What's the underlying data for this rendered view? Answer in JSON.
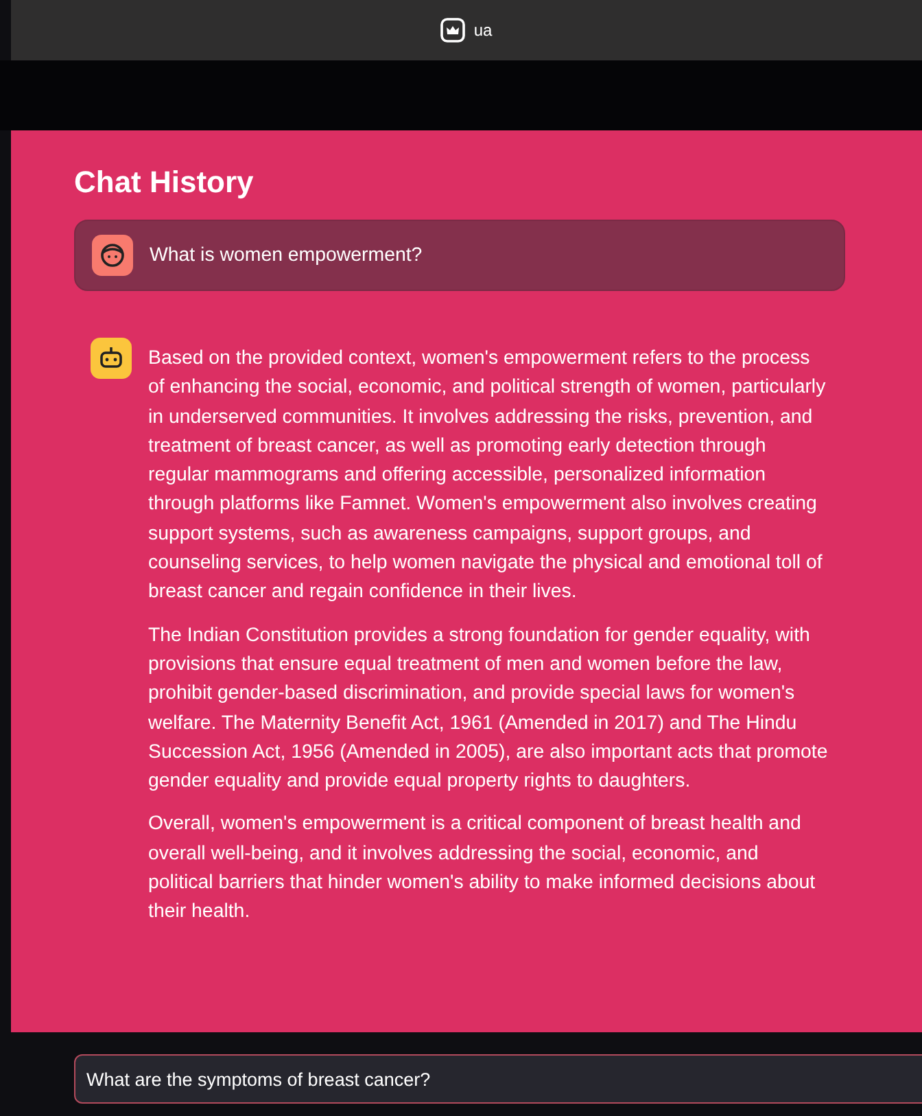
{
  "title_bar": {
    "title": "ua"
  },
  "chat": {
    "heading": "Chat History",
    "messages": [
      {
        "kind": "user",
        "paragraphs": [
          "What is women empowerment?"
        ]
      },
      {
        "kind": "bot",
        "paragraphs": [
          "Based on the provided context, women's empowerment refers to the process of enhancing the social, economic, and political strength of women, particularly in underserved communities. It involves addressing the risks, prevention, and treatment of breast cancer, as well as promoting early detection through regular mammograms and offering accessible, personalized information through platforms like Famnet. Women's empowerment also involves creating support systems, such as awareness campaigns, support groups, and counseling services, to help women navigate the physical and emotional toll of breast cancer and regain confidence in their lives.",
          "The Indian Constitution provides a strong foundation for gender equality, with provisions that ensure equal treatment of men and women before the law, prohibit gender-based discrimination, and provide special laws for women's welfare. The Maternity Benefit Act, 1961 (Amended in 2017) and The Hindu Succession Act, 1956 (Amended in 2005), are also important acts that promote gender equality and provide equal property rights to daughters.",
          "Overall, women's empowerment is a critical component of breast health and overall well-being, and it involves addressing the social, economic, and political barriers that hinder women's ability to make informed decisions about their health."
        ]
      }
    ]
  },
  "input": {
    "value": "What are the symptoms of breast cancer?"
  }
}
